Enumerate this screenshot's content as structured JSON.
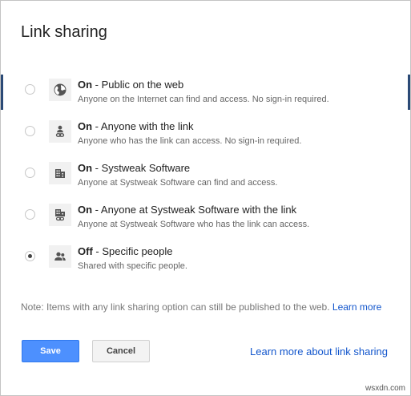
{
  "dialog": {
    "title": "Link sharing"
  },
  "options": [
    {
      "state": "On",
      "title": " - Public on the web",
      "description": "Anyone on the Internet can find and access. No sign-in required.",
      "icon": "globe-icon",
      "selected": false
    },
    {
      "state": "On",
      "title": " - Anyone with the link",
      "description": "Anyone who has the link can access. No sign-in required.",
      "icon": "person-link-icon",
      "selected": false
    },
    {
      "state": "On",
      "title": " - Systweak Software",
      "description": "Anyone at Systweak Software can find and access.",
      "icon": "building-icon",
      "selected": false
    },
    {
      "state": "On",
      "title": " - Anyone at Systweak Software with the link",
      "description": "Anyone at Systweak Software who has the link can access.",
      "icon": "building-link-icon",
      "selected": false
    },
    {
      "state": "Off",
      "title": " - Specific people",
      "description": "Shared with specific people.",
      "icon": "people-icon",
      "selected": true
    }
  ],
  "note": {
    "text": "Note: Items with any link sharing option can still be published to the web. ",
    "link": "Learn more"
  },
  "footer": {
    "save_label": "Save",
    "cancel_label": "Cancel",
    "learn_more_label": "Learn more about link sharing"
  },
  "watermark": "wsxdn.com",
  "colors": {
    "primary": "#4d90fe",
    "link": "#1155cc"
  }
}
